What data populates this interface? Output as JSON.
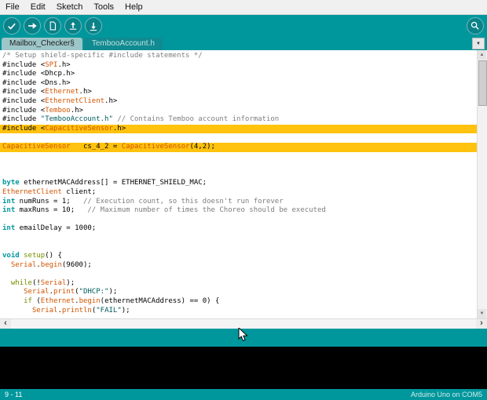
{
  "colors": {
    "accent": "#00979C",
    "highlight": "#FFC20E",
    "console_bg": "#000000"
  },
  "menu": {
    "items": [
      "File",
      "Edit",
      "Sketch",
      "Tools",
      "Help"
    ]
  },
  "toolbar": {
    "buttons": [
      {
        "label": "Verify",
        "icon": "check-icon"
      },
      {
        "label": "Upload",
        "icon": "arrow-right-icon"
      },
      {
        "label": "New",
        "icon": "document-icon"
      },
      {
        "label": "Open",
        "icon": "arrow-up-icon"
      },
      {
        "label": "Save",
        "icon": "arrow-down-icon"
      }
    ],
    "serial_monitor": {
      "label": "Serial Monitor",
      "icon": "magnifier-icon"
    }
  },
  "tabs": [
    {
      "label": "Mailbox_Checker§",
      "active": true
    },
    {
      "label": "TembooAccount.h",
      "active": false
    }
  ],
  "icons": {
    "dropdown": "▼",
    "up": "▲",
    "down": "▼",
    "left": "‹",
    "right": "›"
  },
  "editor": {
    "highlight_color": "#FFC20E",
    "lines": [
      {
        "tokens": [
          [
            "c",
            "/* Setup shield-specific #include statements */"
          ]
        ]
      },
      {
        "tokens": [
          [
            "p",
            "#include <"
          ],
          [
            "o",
            "SPI"
          ],
          [
            "p",
            ".h>"
          ]
        ]
      },
      {
        "tokens": [
          [
            "p",
            "#include <Dhcp.h>"
          ]
        ]
      },
      {
        "tokens": [
          [
            "p",
            "#include <Dns.h>"
          ]
        ]
      },
      {
        "tokens": [
          [
            "p",
            "#include <"
          ],
          [
            "o",
            "Ethernet"
          ],
          [
            "p",
            ".h>"
          ]
        ]
      },
      {
        "tokens": [
          [
            "p",
            "#include <"
          ],
          [
            "o",
            "EthernetClient"
          ],
          [
            "p",
            ".h>"
          ]
        ]
      },
      {
        "tokens": [
          [
            "p",
            "#include <"
          ],
          [
            "o",
            "Temboo"
          ],
          [
            "p",
            ".h>"
          ]
        ]
      },
      {
        "tokens": [
          [
            "p",
            "#include "
          ],
          [
            "s",
            "\"TembooAccount.h\""
          ],
          [
            "p",
            " "
          ],
          [
            "c",
            "// Contains Temboo account information"
          ]
        ]
      },
      {
        "hl": true,
        "tokens": [
          [
            "p",
            "#include <"
          ],
          [
            "o",
            "CapacitiveSensor"
          ],
          [
            "p",
            ".h>"
          ]
        ]
      },
      {
        "tokens": []
      },
      {
        "hl": true,
        "tokens": [
          [
            "o",
            "CapacitiveSensor"
          ],
          [
            "p",
            "   cs_4_2 = "
          ],
          [
            "o",
            "CapacitiveSensor"
          ],
          [
            "p",
            "(4,2);"
          ]
        ]
      },
      {
        "tokens": []
      },
      {
        "tokens": []
      },
      {
        "tokens": []
      },
      {
        "tokens": [
          [
            "t",
            "byte"
          ],
          [
            "p",
            " ethernetMACAddress[] = ETHERNET_SHIELD_MAC;"
          ]
        ]
      },
      {
        "tokens": [
          [
            "o",
            "EthernetClient"
          ],
          [
            "p",
            " client;"
          ]
        ]
      },
      {
        "tokens": [
          [
            "t",
            "int"
          ],
          [
            "p",
            " numRuns = 1;   "
          ],
          [
            "c",
            "// Execution count, so this doesn't run forever"
          ]
        ]
      },
      {
        "tokens": [
          [
            "t",
            "int"
          ],
          [
            "p",
            " maxRuns = 10;   "
          ],
          [
            "c",
            "// Maximum number of times the Choreo should be executed"
          ]
        ]
      },
      {
        "tokens": []
      },
      {
        "tokens": [
          [
            "t",
            "int"
          ],
          [
            "p",
            " emailDelay = 1000;"
          ]
        ]
      },
      {
        "tokens": []
      },
      {
        "tokens": []
      },
      {
        "tokens": [
          [
            "t",
            "void"
          ],
          [
            "p",
            " "
          ],
          [
            "k",
            "setup"
          ],
          [
            "p",
            "() {"
          ]
        ]
      },
      {
        "tokens": [
          [
            "p",
            "  "
          ],
          [
            "o",
            "Serial"
          ],
          [
            "p",
            "."
          ],
          [
            "o",
            "begin"
          ],
          [
            "p",
            "(9600);"
          ]
        ]
      },
      {
        "tokens": []
      },
      {
        "tokens": [
          [
            "p",
            "  "
          ],
          [
            "k",
            "while"
          ],
          [
            "p",
            "(!"
          ],
          [
            "o",
            "Serial"
          ],
          [
            "p",
            ");"
          ]
        ]
      },
      {
        "tokens": [
          [
            "p",
            "     "
          ],
          [
            "o",
            "Serial"
          ],
          [
            "p",
            "."
          ],
          [
            "o",
            "print"
          ],
          [
            "p",
            "("
          ],
          [
            "s",
            "\"DHCP:\""
          ],
          [
            "p",
            ");"
          ]
        ]
      },
      {
        "tokens": [
          [
            "p",
            "     "
          ],
          [
            "k",
            "if"
          ],
          [
            "p",
            " ("
          ],
          [
            "o",
            "Ethernet"
          ],
          [
            "p",
            "."
          ],
          [
            "o",
            "begin"
          ],
          [
            "p",
            "(ethernetMACAddress) == 0) {"
          ]
        ]
      },
      {
        "tokens": [
          [
            "p",
            "       "
          ],
          [
            "o",
            "Serial"
          ],
          [
            "p",
            "."
          ],
          [
            "o",
            "println"
          ],
          [
            "p",
            "("
          ],
          [
            "s",
            "\"FAIL\""
          ],
          [
            "p",
            ");"
          ]
        ]
      }
    ]
  },
  "statusbar": {
    "left": "9 - 11",
    "right": "Arduino Uno on COM5"
  }
}
